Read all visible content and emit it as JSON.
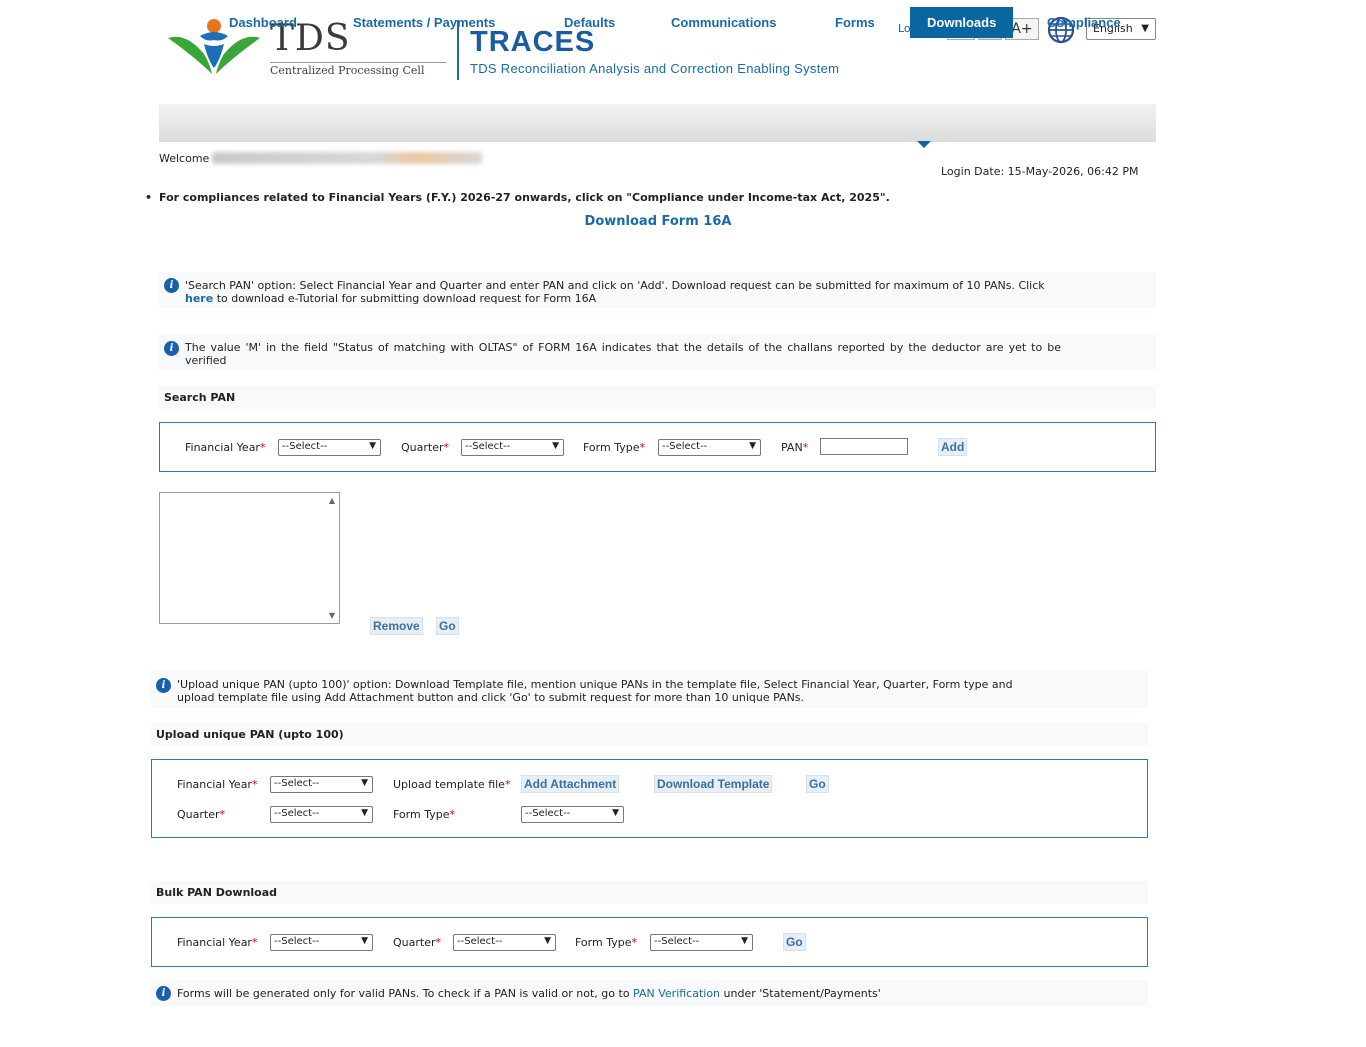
{
  "header": {
    "tds_logo_text": "TDS",
    "tds_logo_sub": "Centralized Processing Cell",
    "app_title": "TRACES",
    "app_subtitle": "TDS Reconciliation Analysis and Correction Enabling System",
    "logout": "Logout",
    "font_decrease": "A-",
    "font_normal": "A",
    "font_increase": "A+",
    "language": "English",
    "globe_icon": "globe-icon"
  },
  "nav": {
    "items": [
      {
        "label": "Dashboard"
      },
      {
        "label": "Statements / Payments"
      },
      {
        "label": "Defaults"
      },
      {
        "label": "Communications"
      },
      {
        "label": "Forms"
      },
      {
        "label": "Downloads",
        "active": true
      },
      {
        "label": "Compliance"
      }
    ]
  },
  "session": {
    "welcome": "Welcome",
    "login_date": "Login Date: 15-May-2026, 06:42 PM"
  },
  "notice": "For compliances related to Financial Years (F.Y.) 2026-27 onwards, click on \"Compliance under Income-tax Act, 2025\".",
  "page_title": "Download Form 16A",
  "info1": {
    "text_a": "'Search PAN' option: Select Financial Year and Quarter and enter PAN and click on 'Add'. Download request can be submitted for maximum of 10 PANs. Click",
    "link": "here",
    "text_b": "to download e-Tutorial for submitting download request for Form 16A"
  },
  "info2": {
    "text": "The value 'M' in the field \"Status of matching with OLTAS\" of FORM 16A indicates that the details of the challans reported by the deductor are yet to be verified"
  },
  "search_pan": {
    "title": "Search PAN",
    "fy_label": "Financial Year",
    "fy_value": "--Select--",
    "quarter_label": "Quarter",
    "quarter_value": "--Select--",
    "form_type_label": "Form Type",
    "form_type_value": "--Select--",
    "pan_label": "PAN",
    "pan_value": "",
    "add_button": "Add",
    "remove_button": "Remove",
    "go_button": "Go"
  },
  "info3": {
    "text": "'Upload unique PAN (upto 100)' option: Download Template file, mention unique PANs in the template file, Select Financial Year, Quarter, Form type and upload template file using Add Attachment button and click 'Go' to submit request for more than 10 unique PANs."
  },
  "upload_pan": {
    "title": "Upload unique PAN (upto 100)",
    "fy_label": "Financial Year",
    "fy_value": "--Select--",
    "upload_label": "Upload template file",
    "add_attachment": "Add Attachment",
    "download_template": "Download Template",
    "go_button": "Go",
    "quarter_label": "Quarter",
    "quarter_value": "--Select--",
    "form_type_label": "Form Type",
    "form_type_value": "--Select--"
  },
  "bulk_pan": {
    "title": "Bulk PAN Download",
    "fy_label": "Financial Year",
    "fy_value": "--Select--",
    "quarter_label": "Quarter",
    "quarter_value": "--Select--",
    "form_type_label": "Form Type",
    "form_type_value": "--Select--",
    "go_button": "Go"
  },
  "info4": {
    "text_a": "Forms will be generated only for valid PANs. To check if a PAN is valid or not, go to",
    "link": "PAN Verification",
    "text_b": "under 'Statement/Payments'"
  },
  "colors": {
    "primary": "#1a6aa8",
    "nav_active": "#0a66a0",
    "required": "#dd0000"
  }
}
